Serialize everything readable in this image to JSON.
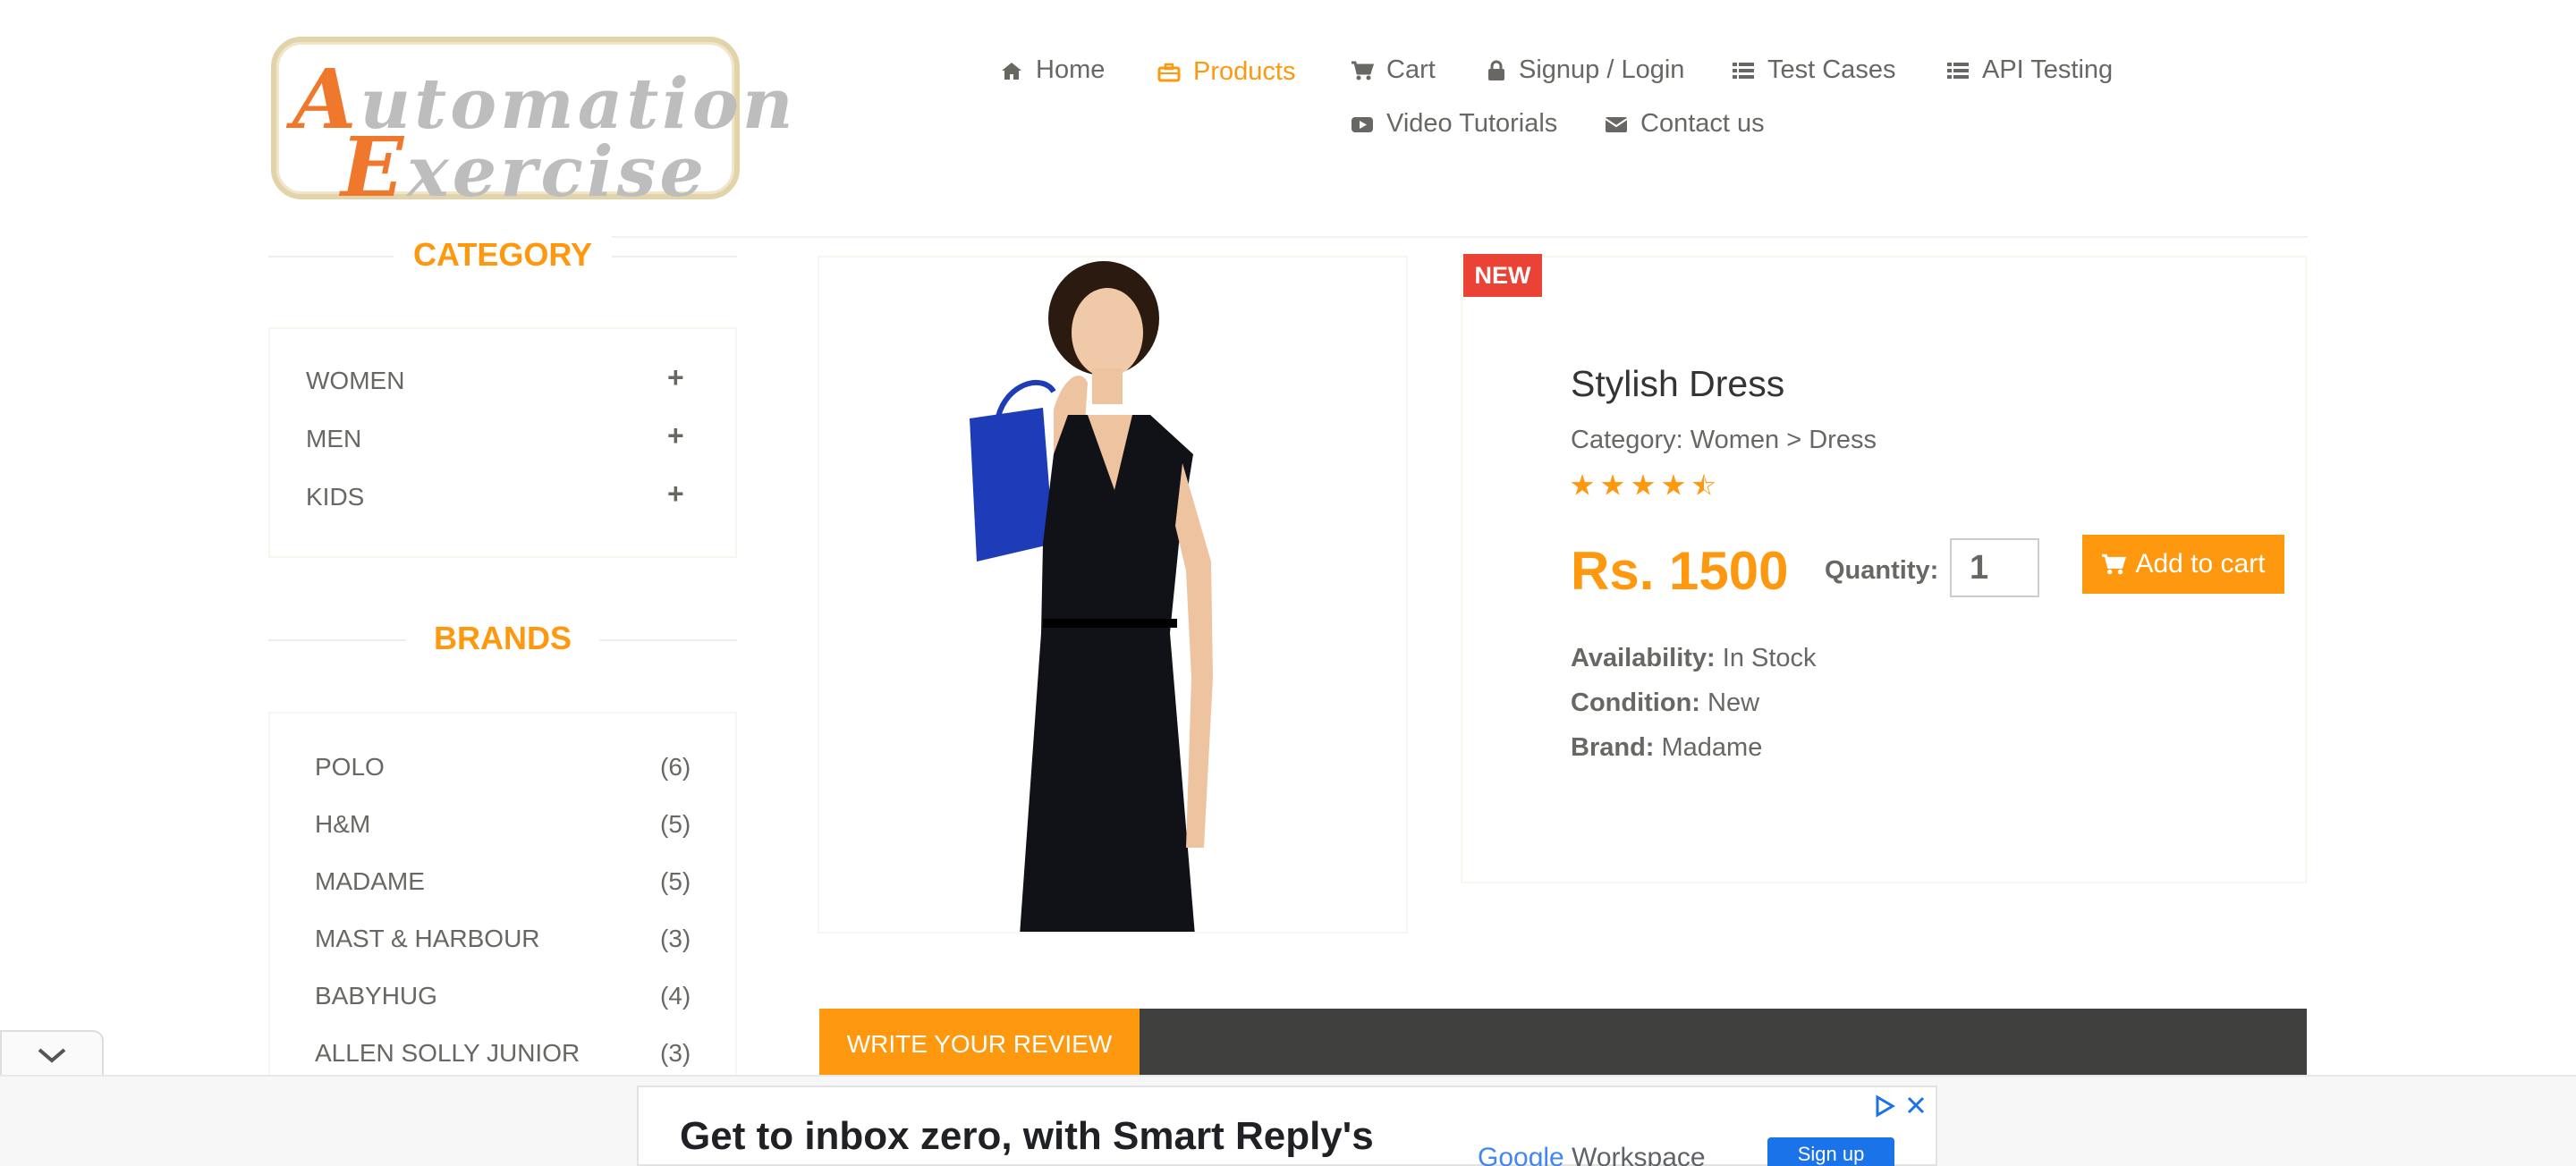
{
  "logo": {
    "line1": "Automation",
    "line2": "Exercise"
  },
  "nav": {
    "items": [
      {
        "label": "Home",
        "icon": "home-icon"
      },
      {
        "label": "Products",
        "icon": "briefcase-icon",
        "active": true
      },
      {
        "label": "Cart",
        "icon": "cart-icon"
      },
      {
        "label": "Signup / Login",
        "icon": "lock-icon"
      },
      {
        "label": "Test Cases",
        "icon": "list-icon"
      },
      {
        "label": "API Testing",
        "icon": "list-icon"
      },
      {
        "label": "Video Tutorials",
        "icon": "youtube-icon"
      },
      {
        "label": "Contact us",
        "icon": "envelope-icon"
      }
    ]
  },
  "sidebar": {
    "category_title": "CATEGORY",
    "categories": [
      "WOMEN",
      "MEN",
      "KIDS"
    ],
    "plus": "+",
    "brands_title": "BRANDS",
    "brands": [
      {
        "name": "POLO",
        "count": "(6)"
      },
      {
        "name": "H&M",
        "count": "(5)"
      },
      {
        "name": "MADAME",
        "count": "(5)"
      },
      {
        "name": "MAST & HARBOUR",
        "count": "(3)"
      },
      {
        "name": "BABYHUG",
        "count": "(4)"
      },
      {
        "name": "ALLEN SOLLY JUNIOR",
        "count": "(3)"
      }
    ]
  },
  "product": {
    "badge": "NEW",
    "name": "Stylish Dress",
    "category": "Category: Women > Dress",
    "rating": 4.5,
    "price": "Rs. 1500",
    "quantity_label": "Quantity:",
    "quantity": "1",
    "add_to_cart": "Add to cart",
    "availability_label": "Availability:",
    "availability": "In Stock",
    "condition_label": "Condition:",
    "condition": "New",
    "brand_label": "Brand:",
    "brand": "Madame"
  },
  "review": {
    "tab": "WRITE YOUR REVIEW"
  },
  "ad": {
    "headline": "Get to inbox zero, with Smart Reply's",
    "brand_google": "Google",
    "brand_workspace": "Workspace",
    "cta": "Sign up"
  },
  "colors": {
    "accent": "#fe980f",
    "badge": "#ea4335",
    "review_bar": "#40403e",
    "text": "#696763"
  }
}
